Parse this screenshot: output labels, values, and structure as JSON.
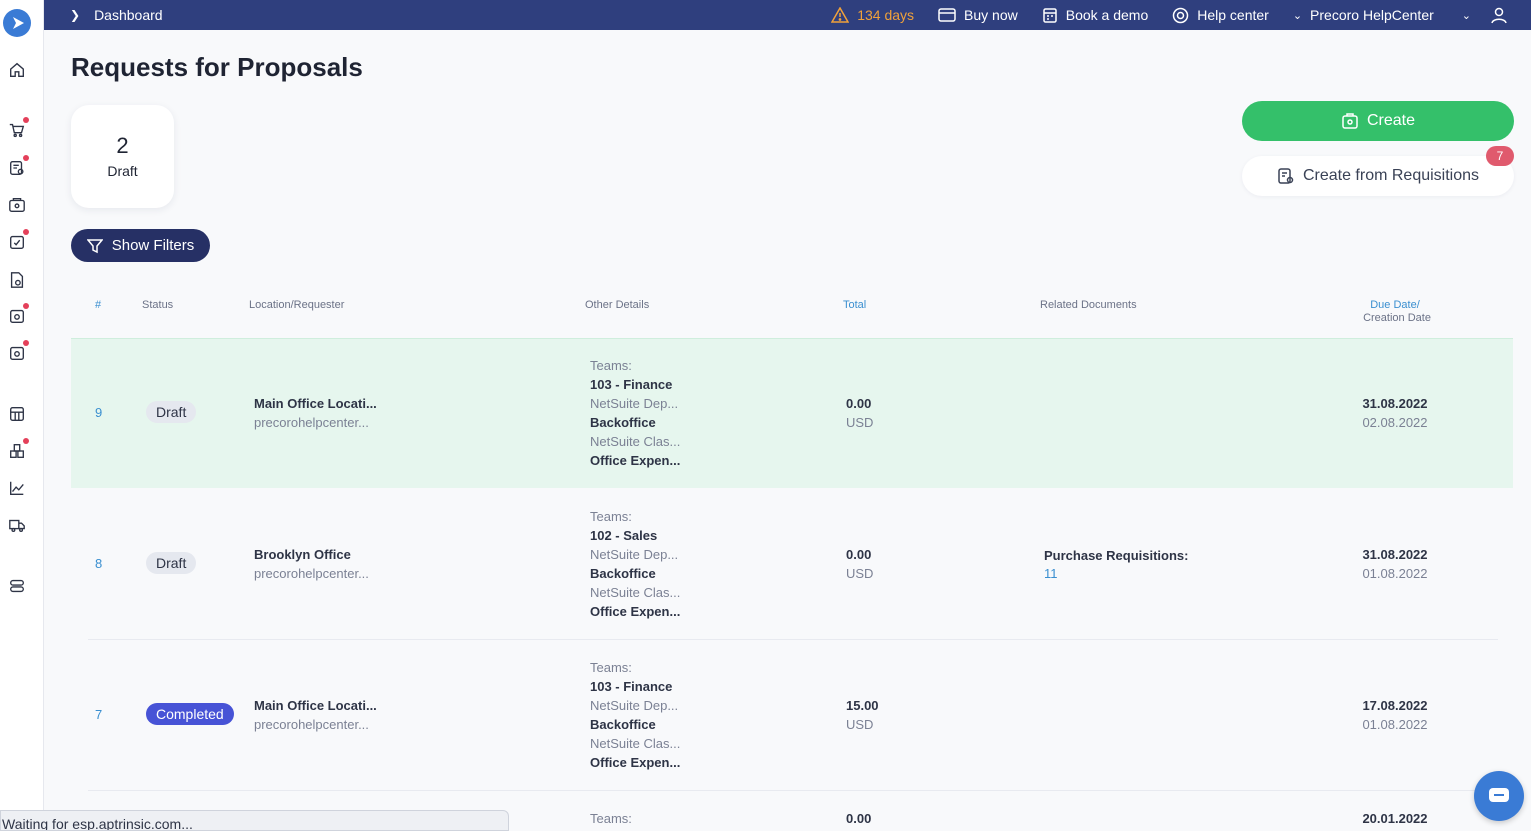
{
  "topbar": {
    "breadcrumb": "Dashboard",
    "trial": "134 days",
    "buy_now": "Buy now",
    "book_demo": "Book a demo",
    "help_center": "Help center",
    "account": "Precoro HelpCenter"
  },
  "page": {
    "title": "Requests for Proposals",
    "stat": {
      "count": "2",
      "label": "Draft"
    },
    "create_label": "Create",
    "create_from_req_label": "Create from Requisitions",
    "req_badge": "7",
    "filters_label": "Show Filters"
  },
  "table": {
    "headers": {
      "id": "#",
      "status": "Status",
      "location": "Location/Requester",
      "details": "Other Details",
      "total": "Total",
      "related": "Related Documents",
      "due": "Due Date/",
      "created": "Creation Date"
    },
    "rows": [
      {
        "id": "9",
        "status": "Draft",
        "location": "Main Office Locati...",
        "requester": "precorohelpcenter...",
        "teams_label": "Teams:",
        "team": "103 - Finance",
        "dep_label": "NetSuite Dep...",
        "dep": "Backoffice",
        "class_label": "NetSuite Clas...",
        "class": "Office Expen...",
        "total": "0.00",
        "currency": "USD",
        "related_label": "",
        "related_link": "",
        "due": "31.08.2022",
        "created": "02.08.2022"
      },
      {
        "id": "8",
        "status": "Draft",
        "location": "Brooklyn Office",
        "requester": "precorohelpcenter...",
        "teams_label": "Teams:",
        "team": "102 - Sales",
        "dep_label": "NetSuite Dep...",
        "dep": "Backoffice",
        "class_label": "NetSuite Clas...",
        "class": "Office Expen...",
        "total": "0.00",
        "currency": "USD",
        "related_label": "Purchase Requisitions:",
        "related_link": "11",
        "due": "31.08.2022",
        "created": "01.08.2022"
      },
      {
        "id": "7",
        "status": "Completed",
        "location": "Main Office Locati...",
        "requester": "precorohelpcenter...",
        "teams_label": "Teams:",
        "team": "103 - Finance",
        "dep_label": "NetSuite Dep...",
        "dep": "Backoffice",
        "class_label": "NetSuite Clas...",
        "class": "Office Expen...",
        "total": "15.00",
        "currency": "USD",
        "related_label": "",
        "related_link": "",
        "due": "17.08.2022",
        "created": "01.08.2022"
      },
      {
        "teams_label": "Teams:",
        "total": "0.00",
        "due": "20.01.2022"
      }
    ]
  },
  "statusbar": "Waiting for esp.aptrinsic.com...",
  "colors": {
    "topbar": "#2f3f7e",
    "create": "#34c06a",
    "filters": "#263065",
    "completed": "#4753d6",
    "link": "#3a8fd0",
    "highlight_row": "#e6f6ee"
  }
}
